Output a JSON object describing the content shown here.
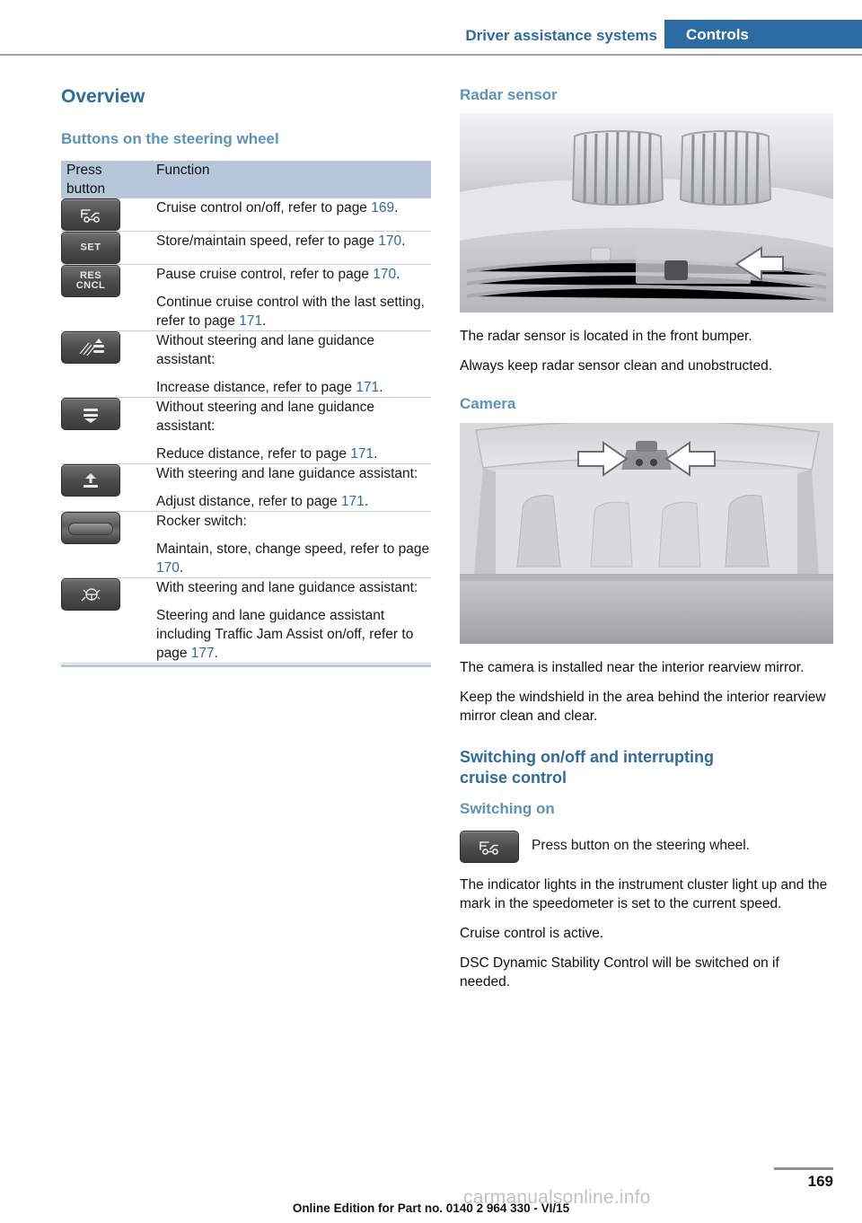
{
  "header": {
    "chapter": "Driver assistance systems",
    "section": "Controls"
  },
  "left": {
    "title": "Overview",
    "subtitle": "Buttons on the steering wheel",
    "table": {
      "headers": [
        "Press\nbutton",
        "Function"
      ],
      "header_col1_line1": "Press",
      "header_col1_line2": "button",
      "header_col2": "Function",
      "rows": [
        {
          "icon": "cruise-control-icon",
          "lines": [
            {
              "text_before": "Cruise control on/off, refer to page ",
              "page": "169",
              "text_after": "."
            }
          ]
        },
        {
          "icon": "set-button-icon",
          "icon_label": "SET",
          "lines": [
            {
              "text_before": "Store/maintain speed, refer to page ",
              "page": "170",
              "text_after": "."
            }
          ]
        },
        {
          "icon": "res-cncl-button-icon",
          "icon_label_line1": "RES",
          "icon_label_line2": "CNCL",
          "lines": [
            {
              "text_before": "Pause cruise control, refer to page ",
              "page": "170",
              "text_after": "."
            },
            {
              "text_before": "Continue cruise control with the last setting, refer to page ",
              "page": "171",
              "text_after": "."
            }
          ]
        },
        {
          "icon": "increase-distance-icon",
          "lines": [
            {
              "text_before": "Without steering and lane guidance assistant:",
              "page": "",
              "text_after": ""
            },
            {
              "text_before": "Increase distance, refer to page ",
              "page": "171",
              "text_after": "."
            }
          ]
        },
        {
          "icon": "reduce-distance-icon",
          "lines": [
            {
              "text_before": "Without steering and lane guidance assistant:",
              "page": "",
              "text_after": ""
            },
            {
              "text_before": "Reduce distance, refer to page ",
              "page": "171",
              "text_after": "."
            }
          ]
        },
        {
          "icon": "adjust-distance-icon",
          "lines": [
            {
              "text_before": "With steering and lane guidance assistant:",
              "page": "",
              "text_after": ""
            },
            {
              "text_before": "Adjust distance, refer to page ",
              "page": "171",
              "text_after": "."
            }
          ]
        },
        {
          "icon": "rocker-switch-icon",
          "lines": [
            {
              "text_before": "Rocker switch:",
              "page": "",
              "text_after": ""
            },
            {
              "text_before": "Maintain, store, change speed, refer to page ",
              "page": "170",
              "text_after": "."
            }
          ]
        },
        {
          "icon": "steering-lane-guidance-icon",
          "lines": [
            {
              "text_before": "With steering and lane guidance assistant:",
              "page": "",
              "text_after": ""
            },
            {
              "text_before": "Steering and lane guidance assistant including Traffic Jam Assist on/off, refer to page ",
              "page": "177",
              "text_after": "."
            }
          ]
        }
      ]
    }
  },
  "right": {
    "radar": {
      "heading": "Radar sensor",
      "figure_alt": "front-bumper-radar-sensor-photo",
      "paragraphs": [
        "The radar sensor is located in the front bumper.",
        "Always keep radar sensor clean and unobstructed."
      ]
    },
    "camera": {
      "heading": "Camera",
      "figure_alt": "interior-rearview-mirror-camera-photo",
      "paragraphs": [
        "The camera is installed near the interior rearview mirror.",
        "Keep the windshield in the area behind the interior rearview mirror clean and clear."
      ]
    },
    "switching": {
      "heading_line1": "Switching on/off and interrupting",
      "heading_line2": "cruise control",
      "subheading": "Switching on",
      "button_icon": "cruise-control-icon",
      "button_text": "Press button on the steering wheel.",
      "paragraphs": [
        "The indicator lights in the instrument cluster light up and the mark in the speedometer is set to the current speed.",
        "Cruise control is active.",
        "DSC Dynamic Stability Control will be switched on if needed."
      ]
    }
  },
  "footer": {
    "page_number": "169",
    "note": "Online Edition for Part no. 0140 2 964 330 - VI/15",
    "watermark": "carmanualsonline.info"
  },
  "colors": {
    "accent": "#2d6ca2",
    "subheading": "#5b93bf",
    "table_header_bg": "#b6c7da"
  }
}
